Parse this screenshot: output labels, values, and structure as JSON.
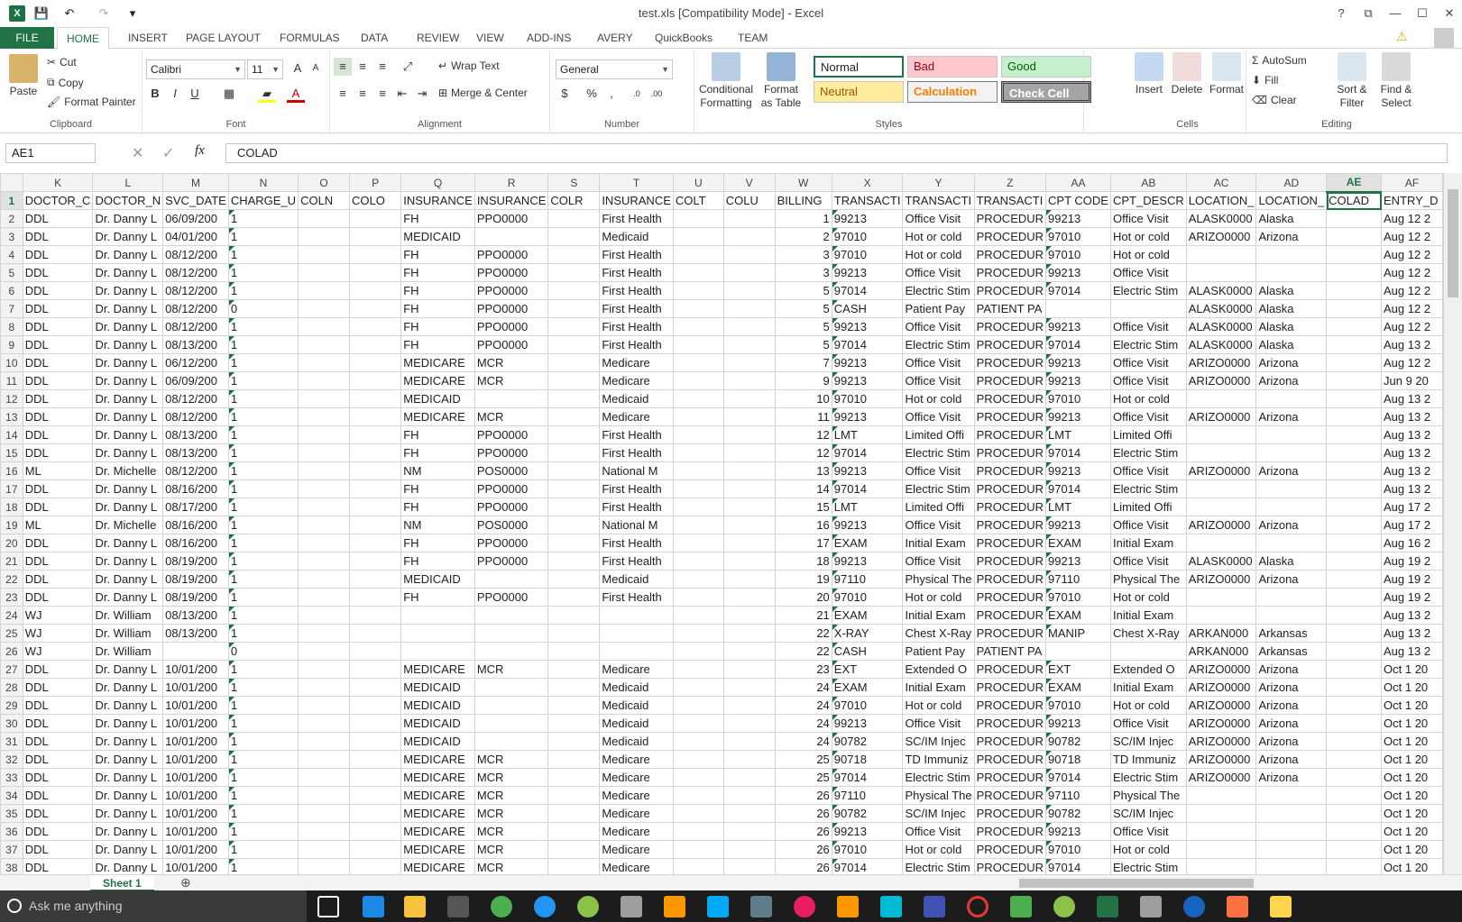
{
  "window": {
    "title": "test.xls  [Compatibility Mode] - Excel",
    "help_label": "?",
    "restore_label": "⧉",
    "minimize_label": "—",
    "maximize_label": "☐",
    "close_label": "✕"
  },
  "qat": {
    "logo": "X",
    "save": "💾",
    "undo": "↶",
    "redo": "↷",
    "customize": "▾"
  },
  "tabs": [
    "FILE",
    "HOME",
    "INSERT",
    "PAGE LAYOUT",
    "FORMULAS",
    "DATA",
    "REVIEW",
    "VIEW",
    "ADD-INS",
    "AVERY",
    "QuickBooks",
    "TEAM"
  ],
  "ribbon": {
    "clipboard": {
      "paste": "Paste",
      "cut": "Cut",
      "copy": "Copy",
      "format_painter": "Format Painter",
      "label": "Clipboard"
    },
    "font": {
      "name": "Calibri",
      "size": "11",
      "label": "Font"
    },
    "alignment": {
      "wrap": "Wrap Text",
      "merge": "Merge & Center",
      "label": "Alignment"
    },
    "number": {
      "format": "General",
      "label": "Number"
    },
    "styles": {
      "conditional": "Conditional Formatting",
      "format_table": "Format as Table",
      "normal": "Normal",
      "bad": "Bad",
      "good": "Good",
      "neutral": "Neutral",
      "calculation": "Calculation",
      "check_cell": "Check Cell",
      "label": "Styles"
    },
    "cells": {
      "insert": "Insert",
      "delete": "Delete",
      "format": "Format",
      "label": "Cells"
    },
    "editing": {
      "autosum": "AutoSum",
      "fill": "Fill",
      "clear": "Clear",
      "sort": "Sort & Filter",
      "find": "Find & Select",
      "label": "Editing"
    }
  },
  "formula_bar": {
    "name_box": "AE1",
    "fx": "fx",
    "value": "COLAD"
  },
  "columns": [
    "K",
    "L",
    "M",
    "N",
    "O",
    "P",
    "Q",
    "R",
    "S",
    "T",
    "U",
    "V",
    "W",
    "X",
    "Y",
    "Z",
    "AA",
    "AB",
    "AC",
    "AD",
    "AE",
    "AF"
  ],
  "headers": [
    "DOCTOR_C",
    "DOCTOR_N",
    "SVC_DATE",
    "CHARGE_U",
    "COLN",
    "COLO",
    "INSURANCE",
    "INSURANCE",
    "COLR",
    "INSURANCE",
    "COLT",
    "COLU",
    "BILLING",
    "TRANSACTI",
    "TRANSACTI",
    "TRANSACTI",
    "CPT CODE",
    "CPT_DESCR",
    "LOCATION_",
    "LOCATION_",
    "COLAD",
    "ENTRY_D"
  ],
  "rows": [
    [
      "DDL",
      "Dr. Danny L",
      "06/09/200",
      "1",
      "",
      "",
      "FH",
      "PPO0000",
      "",
      "First Health",
      "",
      "",
      "1",
      "99213",
      "Office Visit",
      "PROCEDUR",
      "99213",
      "Office Visit",
      "ALASK0000",
      "Alaska",
      "",
      "Aug 12 2"
    ],
    [
      "DDL",
      "Dr. Danny L",
      "04/01/200",
      "1",
      "",
      "",
      "MEDICAID",
      "",
      "",
      "Medicaid",
      "",
      "",
      "2",
      "97010",
      "Hot or cold",
      "PROCEDUR",
      "97010",
      "Hot or cold",
      "ARIZO0000",
      "Arizona",
      "",
      "Aug 12 2"
    ],
    [
      "DDL",
      "Dr. Danny L",
      "08/12/200",
      "1",
      "",
      "",
      "FH",
      "PPO0000",
      "",
      "First Health",
      "",
      "",
      "3",
      "97010",
      "Hot or cold",
      "PROCEDUR",
      "97010",
      "Hot or cold",
      "",
      "",
      "",
      "Aug 12 2"
    ],
    [
      "DDL",
      "Dr. Danny L",
      "08/12/200",
      "1",
      "",
      "",
      "FH",
      "PPO0000",
      "",
      "First Health",
      "",
      "",
      "3",
      "99213",
      "Office Visit",
      "PROCEDUR",
      "99213",
      "Office Visit",
      "",
      "",
      "",
      "Aug 12 2"
    ],
    [
      "DDL",
      "Dr. Danny L",
      "08/12/200",
      "1",
      "",
      "",
      "FH",
      "PPO0000",
      "",
      "First Health",
      "",
      "",
      "5",
      "97014",
      "Electric Stim",
      "PROCEDUR",
      "97014",
      "Electric Stim",
      "ALASK0000",
      "Alaska",
      "",
      "Aug 12 2"
    ],
    [
      "DDL",
      "Dr. Danny L",
      "08/12/200",
      "0",
      "",
      "",
      "FH",
      "PPO0000",
      "",
      "First Health",
      "",
      "",
      "5",
      "CASH",
      "Patient Pay",
      "PATIENT PA",
      "",
      "",
      "ALASK0000",
      "Alaska",
      "",
      "Aug 12 2"
    ],
    [
      "DDL",
      "Dr. Danny L",
      "08/12/200",
      "1",
      "",
      "",
      "FH",
      "PPO0000",
      "",
      "First Health",
      "",
      "",
      "5",
      "99213",
      "Office Visit",
      "PROCEDUR",
      "99213",
      "Office Visit",
      "ALASK0000",
      "Alaska",
      "",
      "Aug 12 2"
    ],
    [
      "DDL",
      "Dr. Danny L",
      "08/13/200",
      "1",
      "",
      "",
      "FH",
      "PPO0000",
      "",
      "First Health",
      "",
      "",
      "5",
      "97014",
      "Electric Stim",
      "PROCEDUR",
      "97014",
      "Electric Stim",
      "ALASK0000",
      "Alaska",
      "",
      "Aug 13 2"
    ],
    [
      "DDL",
      "Dr. Danny L",
      "06/12/200",
      "1",
      "",
      "",
      "MEDICARE",
      "MCR",
      "",
      "Medicare",
      "",
      "",
      "7",
      "99213",
      "Office Visit",
      "PROCEDUR",
      "99213",
      "Office Visit",
      "ARIZO0000",
      "Arizona",
      "",
      "Aug 12 2"
    ],
    [
      "DDL",
      "Dr. Danny L",
      "06/09/200",
      "1",
      "",
      "",
      "MEDICARE",
      "MCR",
      "",
      "Medicare",
      "",
      "",
      "9",
      "99213",
      "Office Visit",
      "PROCEDUR",
      "99213",
      "Office Visit",
      "ARIZO0000",
      "Arizona",
      "",
      "Jun  9 20"
    ],
    [
      "DDL",
      "Dr. Danny L",
      "08/12/200",
      "1",
      "",
      "",
      "MEDICAID",
      "",
      "",
      "Medicaid",
      "",
      "",
      "10",
      "97010",
      "Hot or cold",
      "PROCEDUR",
      "97010",
      "Hot or cold",
      "",
      "",
      "",
      "Aug 13 2"
    ],
    [
      "DDL",
      "Dr. Danny L",
      "08/12/200",
      "1",
      "",
      "",
      "MEDICARE",
      "MCR",
      "",
      "Medicare",
      "",
      "",
      "11",
      "99213",
      "Office Visit",
      "PROCEDUR",
      "99213",
      "Office Visit",
      "ARIZO0000",
      "Arizona",
      "",
      "Aug 13 2"
    ],
    [
      "DDL",
      "Dr. Danny L",
      "08/13/200",
      "1",
      "",
      "",
      "FH",
      "PPO0000",
      "",
      "First Health",
      "",
      "",
      "12",
      "LMT",
      "Limited Offi",
      "PROCEDUR",
      "LMT",
      "Limited Offi",
      "",
      "",
      "",
      "Aug 13 2"
    ],
    [
      "DDL",
      "Dr. Danny L",
      "08/13/200",
      "1",
      "",
      "",
      "FH",
      "PPO0000",
      "",
      "First Health",
      "",
      "",
      "12",
      "97014",
      "Electric Stim",
      "PROCEDUR",
      "97014",
      "Electric Stim",
      "",
      "",
      "",
      "Aug 13 2"
    ],
    [
      "ML",
      "Dr. Michelle",
      "08/12/200",
      "1",
      "",
      "",
      "NM",
      "POS0000",
      "",
      "National M",
      "",
      "",
      "13",
      "99213",
      "Office Visit",
      "PROCEDUR",
      "99213",
      "Office Visit",
      "ARIZO0000",
      "Arizona",
      "",
      "Aug 13 2"
    ],
    [
      "DDL",
      "Dr. Danny L",
      "08/16/200",
      "1",
      "",
      "",
      "FH",
      "PPO0000",
      "",
      "First Health",
      "",
      "",
      "14",
      "97014",
      "Electric Stim",
      "PROCEDUR",
      "97014",
      "Electric Stim",
      "",
      "",
      "",
      "Aug 13 2"
    ],
    [
      "DDL",
      "Dr. Danny L",
      "08/17/200",
      "1",
      "",
      "",
      "FH",
      "PPO0000",
      "",
      "First Health",
      "",
      "",
      "15",
      "LMT",
      "Limited Offi",
      "PROCEDUR",
      "LMT",
      "Limited Offi",
      "",
      "",
      "",
      "Aug 17 2"
    ],
    [
      "ML",
      "Dr. Michelle",
      "08/16/200",
      "1",
      "",
      "",
      "NM",
      "POS0000",
      "",
      "National M",
      "",
      "",
      "16",
      "99213",
      "Office Visit",
      "PROCEDUR",
      "99213",
      "Office Visit",
      "ARIZO0000",
      "Arizona",
      "",
      "Aug 17 2"
    ],
    [
      "DDL",
      "Dr. Danny L",
      "08/16/200",
      "1",
      "",
      "",
      "FH",
      "PPO0000",
      "",
      "First Health",
      "",
      "",
      "17",
      "EXAM",
      "Initial Exam",
      "PROCEDUR",
      "EXAM",
      "Initial Exam",
      "",
      "",
      "",
      "Aug 16 2"
    ],
    [
      "DDL",
      "Dr. Danny L",
      "08/19/200",
      "1",
      "",
      "",
      "FH",
      "PPO0000",
      "",
      "First Health",
      "",
      "",
      "18",
      "99213",
      "Office Visit",
      "PROCEDUR",
      "99213",
      "Office Visit",
      "ALASK0000",
      "Alaska",
      "",
      "Aug 19 2"
    ],
    [
      "DDL",
      "Dr. Danny L",
      "08/19/200",
      "1",
      "",
      "",
      "MEDICAID",
      "",
      "",
      "Medicaid",
      "",
      "",
      "19",
      "97110",
      "Physical The",
      "PROCEDUR",
      "97110",
      "Physical The",
      "ARIZO0000",
      "Arizona",
      "",
      "Aug 19 2"
    ],
    [
      "DDL",
      "Dr. Danny L",
      "08/19/200",
      "1",
      "",
      "",
      "FH",
      "PPO0000",
      "",
      "First Health",
      "",
      "",
      "20",
      "97010",
      "Hot or cold",
      "PROCEDUR",
      "97010",
      "Hot or cold",
      "",
      "",
      "",
      "Aug 19 2"
    ],
    [
      "WJ",
      "Dr. William",
      "08/13/200",
      "1",
      "",
      "",
      "",
      "",
      "",
      "",
      "",
      "",
      "21",
      "EXAM",
      "Initial Exam",
      "PROCEDUR",
      "EXAM",
      "Initial Exam",
      "",
      "",
      "",
      "Aug 13 2"
    ],
    [
      "WJ",
      "Dr. William",
      "08/13/200",
      "1",
      "",
      "",
      "",
      "",
      "",
      "",
      "",
      "",
      "22",
      "X-RAY",
      "Chest X-Ray",
      "PROCEDUR",
      "MANIP",
      "Chest X-Ray",
      "ARKAN000",
      "Arkansas",
      "",
      "Aug 13 2"
    ],
    [
      "WJ",
      "Dr. William",
      "",
      "0",
      "",
      "",
      "",
      "",
      "",
      "",
      "",
      "",
      "22",
      "CASH",
      "Patient Pay",
      "PATIENT PA",
      "",
      "",
      "ARKAN000",
      "Arkansas",
      "",
      "Aug 13 2"
    ],
    [
      "DDL",
      "Dr. Danny L",
      "10/01/200",
      "1",
      "",
      "",
      "MEDICARE",
      "MCR",
      "",
      "Medicare",
      "",
      "",
      "23",
      "EXT",
      "Extended O",
      "PROCEDUR",
      "EXT",
      "Extended O",
      "ARIZO0000",
      "Arizona",
      "",
      "Oct  1 20"
    ],
    [
      "DDL",
      "Dr. Danny L",
      "10/01/200",
      "1",
      "",
      "",
      "MEDICAID",
      "",
      "",
      "Medicaid",
      "",
      "",
      "24",
      "EXAM",
      "Initial Exam",
      "PROCEDUR",
      "EXAM",
      "Initial Exam",
      "ARIZO0000",
      "Arizona",
      "",
      "Oct  1 20"
    ],
    [
      "DDL",
      "Dr. Danny L",
      "10/01/200",
      "1",
      "",
      "",
      "MEDICAID",
      "",
      "",
      "Medicaid",
      "",
      "",
      "24",
      "97010",
      "Hot or cold",
      "PROCEDUR",
      "97010",
      "Hot or cold",
      "ARIZO0000",
      "Arizona",
      "",
      "Oct  1 20"
    ],
    [
      "DDL",
      "Dr. Danny L",
      "10/01/200",
      "1",
      "",
      "",
      "MEDICAID",
      "",
      "",
      "Medicaid",
      "",
      "",
      "24",
      "99213",
      "Office Visit",
      "PROCEDUR",
      "99213",
      "Office Visit",
      "ARIZO0000",
      "Arizona",
      "",
      "Oct  1 20"
    ],
    [
      "DDL",
      "Dr. Danny L",
      "10/01/200",
      "1",
      "",
      "",
      "MEDICAID",
      "",
      "",
      "Medicaid",
      "",
      "",
      "24",
      "90782",
      "SC/IM Injec",
      "PROCEDUR",
      "90782",
      "SC/IM Injec",
      "ARIZO0000",
      "Arizona",
      "",
      "Oct  1 20"
    ],
    [
      "DDL",
      "Dr. Danny L",
      "10/01/200",
      "1",
      "",
      "",
      "MEDICARE",
      "MCR",
      "",
      "Medicare",
      "",
      "",
      "25",
      "90718",
      "TD Immuniz",
      "PROCEDUR",
      "90718",
      "TD Immuniz",
      "ARIZO0000",
      "Arizona",
      "",
      "Oct  1 20"
    ],
    [
      "DDL",
      "Dr. Danny L",
      "10/01/200",
      "1",
      "",
      "",
      "MEDICARE",
      "MCR",
      "",
      "Medicare",
      "",
      "",
      "25",
      "97014",
      "Electric Stim",
      "PROCEDUR",
      "97014",
      "Electric Stim",
      "ARIZO0000",
      "Arizona",
      "",
      "Oct  1 20"
    ],
    [
      "DDL",
      "Dr. Danny L",
      "10/01/200",
      "1",
      "",
      "",
      "MEDICARE",
      "MCR",
      "",
      "Medicare",
      "",
      "",
      "26",
      "97110",
      "Physical The",
      "PROCEDUR",
      "97110",
      "Physical The",
      "",
      "",
      "",
      "Oct  1 20"
    ],
    [
      "DDL",
      "Dr. Danny L",
      "10/01/200",
      "1",
      "",
      "",
      "MEDICARE",
      "MCR",
      "",
      "Medicare",
      "",
      "",
      "26",
      "90782",
      "SC/IM Injec",
      "PROCEDUR",
      "90782",
      "SC/IM Injec",
      "",
      "",
      "",
      "Oct  1 20"
    ],
    [
      "DDL",
      "Dr. Danny L",
      "10/01/200",
      "1",
      "",
      "",
      "MEDICARE",
      "MCR",
      "",
      "Medicare",
      "",
      "",
      "26",
      "99213",
      "Office Visit",
      "PROCEDUR",
      "99213",
      "Office Visit",
      "",
      "",
      "",
      "Oct  1 20"
    ],
    [
      "DDL",
      "Dr. Danny L",
      "10/01/200",
      "1",
      "",
      "",
      "MEDICARE",
      "MCR",
      "",
      "Medicare",
      "",
      "",
      "26",
      "97010",
      "Hot or cold",
      "PROCEDUR",
      "97010",
      "Hot or cold",
      "",
      "",
      "",
      "Oct  1 20"
    ],
    [
      "DDL",
      "Dr. Danny L",
      "10/01/200",
      "1",
      "",
      "",
      "MEDICARE",
      "MCR",
      "",
      "Medicare",
      "",
      "",
      "26",
      "97014",
      "Electric Stim",
      "PROCEDUR",
      "97014",
      "Electric Stim",
      "",
      "",
      "",
      "Oct  1 20"
    ]
  ],
  "sheet": {
    "tab": "Sheet 1",
    "add": "⊕"
  },
  "taskbar": {
    "search_placeholder": "Ask me anything"
  },
  "colors": {
    "excel_green": "#217346",
    "bad_bg": "#ffc7ce",
    "good_bg": "#c6efce",
    "neutral_bg": "#ffeb9c",
    "calc_bg": "#f2f2f2",
    "check_bg": "#a5a5a5"
  }
}
